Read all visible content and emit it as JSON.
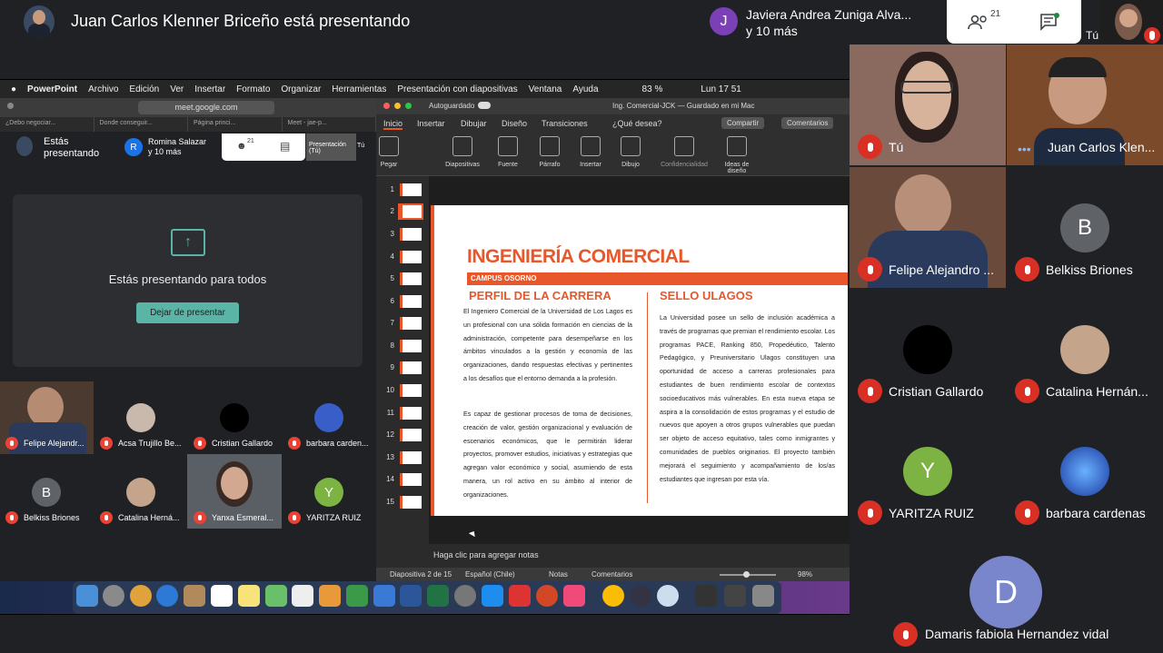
{
  "meet": {
    "presenting_title": "Juan Carlos Klenner Briceño está presentando",
    "join": {
      "initial": "J",
      "line1": "Javiera Andrea Zuniga Alva...",
      "line2": "y 10 más"
    },
    "people_count": "21",
    "self_label": "Tú"
  },
  "mac_menu": [
    "PowerPoint",
    "Archivo",
    "Edición",
    "Ver",
    "Insertar",
    "Formato",
    "Organizar",
    "Herramientas",
    "Presentación con diapositivas",
    "Ventana",
    "Ayuda"
  ],
  "mac_status": {
    "battery": "83 %",
    "clock": "Lun 17 51"
  },
  "chrome": {
    "url": "meet.google.com",
    "tabs": [
      "¿Debo negociar...",
      "Donde conseguir...",
      "Página princi...",
      "Meet - jae-p..."
    ]
  },
  "left_meet": {
    "presenting_line1": "Estás",
    "presenting_line2": "presentando",
    "join_initial": "R",
    "join_line1": "Romina Salazar",
    "join_line2": "y 10 más",
    "people_count": "21",
    "pres_line1": "Presentación",
    "pres_line2": "(Tú)",
    "self_tag": "Tú",
    "card_text": "Estás presentando para todos",
    "stop_button": "Dejar de presentar",
    "tiles": [
      "Felipe Alejandr...",
      "Acsa Trujillo Be...",
      "Cristian Gallardo",
      "barbara carden...",
      "Belkiss Briones",
      "Catalina Herná...",
      "Yanxa Esmeral...",
      "YARITZA RUIZ"
    ],
    "tile_initials": {
      "belkiss": "B",
      "yaritza": "Y"
    }
  },
  "ppt": {
    "title": "Ing. Comercial-JCK — Guardado en mi Mac",
    "autosave": "Autoguardado",
    "tabs": [
      "Inicio",
      "Insertar",
      "Dibujar",
      "Diseño",
      "Transiciones",
      "¿Qué desea?"
    ],
    "share": "Compartir",
    "comments": "Comentarios",
    "ribbon": [
      "Pegar",
      "Diapositivas",
      "Fuente",
      "Párrafo",
      "Insertar",
      "Dibujo",
      "Confidencialidad",
      "Ideas de diseño"
    ],
    "thumb_numbers": [
      "1",
      "2",
      "3",
      "4",
      "5",
      "6",
      "7",
      "8",
      "9",
      "10",
      "11",
      "12",
      "13",
      "14",
      "15"
    ],
    "notes_placeholder": "Haga clic para agregar notas",
    "status": {
      "slide": "Diapositiva 2 de 15",
      "lang": "Español (Chile)",
      "notes": "Notas",
      "comments": "Comentarios",
      "zoom": "98%"
    }
  },
  "slide": {
    "title": "INGENIERÍA COMERCIAL",
    "band": "CAMPUS OSORNO",
    "left_heading": "PERFIL DE LA CARRERA",
    "right_heading": "SELLO ULAGOS",
    "left_p1": "El Ingeniero Comercial de la Universidad de Los Lagos es un profesional con una sólida formación en ciencias de la administración, competente para desempeñarse en los ámbitos vinculados a la gestión y economía de las organizaciones, dando respuestas efectivas y pertinentes a los desafíos que el entorno demanda a la profesión.",
    "left_p2": "Es capaz de gestionar procesos de toma de decisiones, creación de valor, gestión organizacional y evaluación de escenarios económicos, que le permitirán liderar proyectos, promover estudios, iniciativas y estrategias que agregan valor económico y social, asumiendo de esta manera, un rol activo en su ámbito al interior de organizaciones.",
    "right_p": "La Universidad posee un sello de inclusión académica a través de programas que premian el rendimiento escolar. Los programas PACE, Ranking 850, Propedéutico, Talento Pedagógico, y Preuniversitario Ulagos constituyen una oportunidad de acceso a carreras profesionales para estudiantes de buen rendimiento escolar de contextos socioeducativos más vulnerables. En esta nueva etapa se aspira a la consolidación de estos programas y el estudio de nuevos que apoyen a otros grupos vulnerables que puedan ser objeto de acceso equitativo, tales como inmigrantes y comunidades de pueblos originarios. El proyecto también mejorará el seguimiento y acompañamiento de los/as estudiantes que ingresan por esta vía."
  },
  "grid": {
    "tu": "Tú",
    "juan": "Juan Carlos Klen...",
    "felipe": "Felipe Alejandro ...",
    "belkiss": "Belkiss Briones",
    "belkiss_initial": "B",
    "cristian": "Cristian Gallardo",
    "catalina": "Catalina Hernán...",
    "yaritza": "YARITZA RUIZ",
    "yaritza_initial": "Y",
    "barbara": "barbara cardenas",
    "damaris": "Damaris fabiola Hernandez vidal",
    "damaris_initial": "D"
  },
  "colors": {
    "accent_orange": "#e8572a",
    "mic_off": "#d93025",
    "meet_bg": "#202124",
    "teal": "#5bb5a6"
  }
}
